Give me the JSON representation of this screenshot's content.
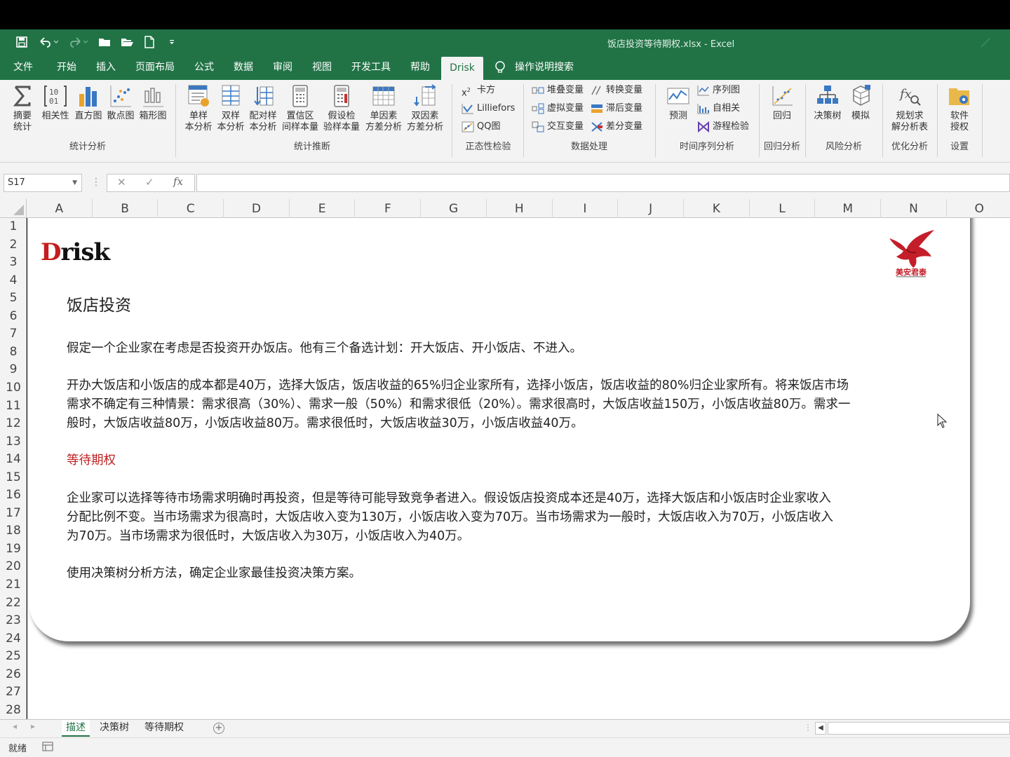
{
  "window": {
    "title": "饭店投资等待期权.xlsx  -  Excel"
  },
  "tabs": [
    {
      "label": "文件"
    },
    {
      "label": "开始"
    },
    {
      "label": "插入"
    },
    {
      "label": "页面布局"
    },
    {
      "label": "公式"
    },
    {
      "label": "数据"
    },
    {
      "label": "审阅"
    },
    {
      "label": "视图"
    },
    {
      "label": "开发工具"
    },
    {
      "label": "帮助"
    },
    {
      "label": "Drisk"
    }
  ],
  "tell_me": "操作说明搜索",
  "ribbon": {
    "stat": {
      "b1a": "摘要",
      "b1b": "统计",
      "b2": "相关性",
      "b3": "直方图",
      "b4": "散点图",
      "b5": "箱形图",
      "label": "统计分析"
    },
    "infer": {
      "b1a": "单样",
      "b1b": "本分析",
      "b2a": "双样",
      "b2b": "本分析",
      "b3a": "配对样",
      "b3b": "本分析",
      "b4a": "置信区",
      "b4b": "间样本量",
      "b5a": "假设检",
      "b5b": "验样本量",
      "b6a": "单因素",
      "b6b": "方差分析",
      "b7a": "双因素",
      "b7b": "方差分析",
      "label": "统计推断"
    },
    "normal": {
      "b1": "卡方",
      "b2": "Lilliefors",
      "b3": "QQ图",
      "label": "正态性检验"
    },
    "data": {
      "b1": "堆叠变量",
      "b2": "虚拟变量",
      "b3": "交互变量",
      "b4": "转换变量",
      "b5": "滞后变量",
      "b6": "差分变量",
      "label": "数据处理"
    },
    "ts": {
      "b1": "预测",
      "b2": "序列图",
      "b3": "自相关",
      "b4": "游程检验",
      "label": "时间序列分析"
    },
    "reg": {
      "b1": "回归",
      "label": "回归分析"
    },
    "risk": {
      "b1": "决策树",
      "b2": "模拟",
      "label": "风险分析"
    },
    "opt": {
      "b1a": "规划求",
      "b1b": "解分析表",
      "label": "优化分析"
    },
    "set": {
      "b1a": "软件",
      "b1b": "授权",
      "label": "设置"
    }
  },
  "formula": {
    "namebox": "S17",
    "fx": "fx"
  },
  "columns": [
    "A",
    "B",
    "C",
    "D",
    "E",
    "F",
    "G",
    "H",
    "I",
    "J",
    "K",
    "L",
    "M",
    "N",
    "O"
  ],
  "rows": [
    "1",
    "2",
    "3",
    "4",
    "5",
    "6",
    "7",
    "8",
    "9",
    "10",
    "11",
    "12",
    "13",
    "14",
    "15",
    "16",
    "17",
    "18",
    "19",
    "20",
    "21",
    "22",
    "23",
    "24",
    "25",
    "26",
    "27",
    "28"
  ],
  "doc": {
    "logo_d": "D",
    "logo_rest": "risk",
    "brand_text": "美安君泰",
    "title": "饭店投资",
    "p1": "假定一个企业家在考虑是否投资开办饭店。他有三个备选计划：开大饭店、开小饭店、不进入。",
    "p2_l1": "开办大饭店和小饭店的成本都是40万，选择大饭店，饭店收益的65%归企业家所有，选择小饭店，饭店收益的80%归企业家所有。将来饭店市场",
    "p2_l2": "需求不确定有三种情景：需求很高（30%）、需求一般（50%）和需求很低（20%）。需求很高时，大饭店收益150万，小饭店收益80万。需求一",
    "p2_l3": "般时，大饭店收益80万，小饭店收益80万。需求很低时，大饭店收益30万，小饭店收益40万。",
    "subtitle": "等待期权",
    "p3_l1": "企业家可以选择等待市场需求明确时再投资，但是等待可能导致竞争者进入。假设饭店投资成本还是40万，选择大饭店和小饭店时企业家收入",
    "p3_l2": "分配比例不变。当市场需求为很高时，大饭店收入变为130万，小饭店收入变为70万。当市场需求为一般时，大饭店收入为70万，小饭店收入",
    "p3_l3": "为70万。当市场需求为很低时，大饭店收入为30万，小饭店收入为40万。",
    "p4": "使用决策树分析方法，确定企业家最佳投资决策方案。"
  },
  "sheets": [
    {
      "label": "描述"
    },
    {
      "label": "决策树"
    },
    {
      "label": "等待期权"
    }
  ],
  "status": {
    "ready": "就绪"
  }
}
